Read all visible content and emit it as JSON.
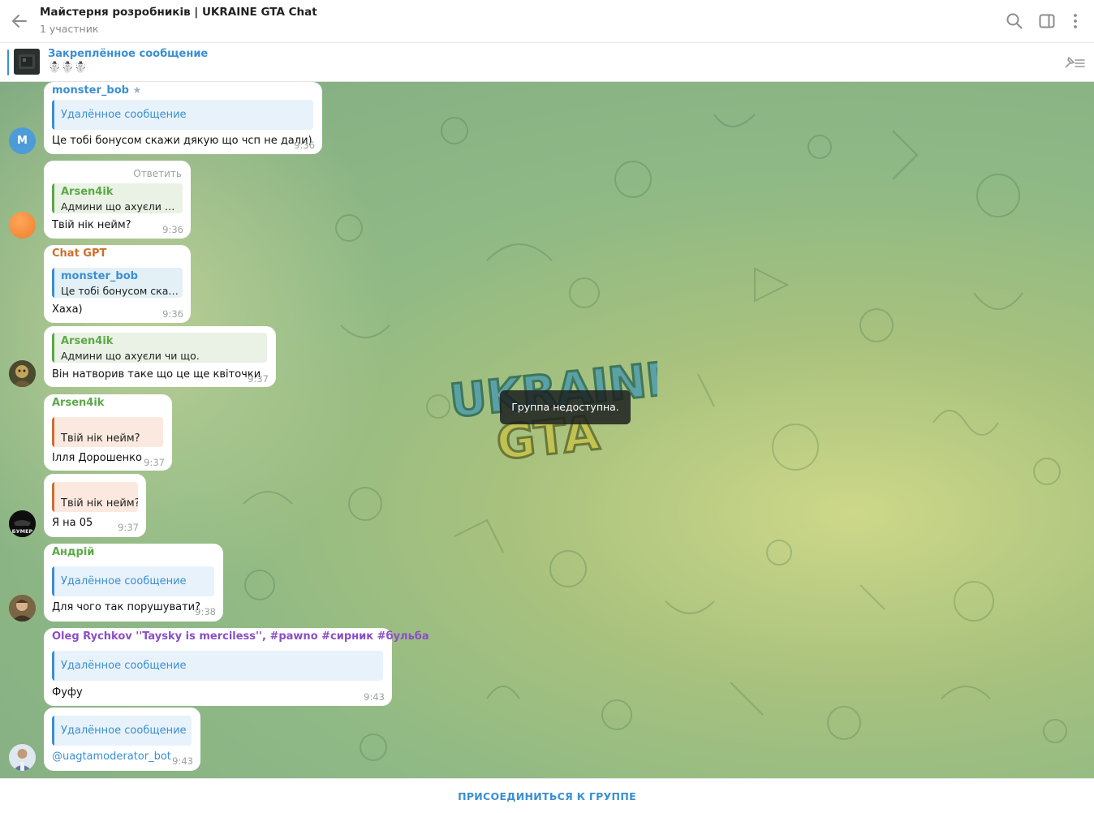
{
  "header": {
    "title": "Майстерня розробників | UKRAINE GTA Chat",
    "subtitle": "1 участник"
  },
  "pinned": {
    "title": "Закреплённое сообщение",
    "text": "☃️☃️☃️"
  },
  "toast": "Группа недоступна.",
  "colors": {
    "accent": "#3a8fd3",
    "monster_bob": "#3a8fd3",
    "arsen4ik": "#5ba946",
    "chat_gpt": "#cc6f2e",
    "andriy": "#5ba946",
    "oleg": "#8a4fc6"
  },
  "messages": [
    {
      "sender": "monster_bob",
      "reply": "Удалённое сообщение",
      "text": "Це тобі бонусом скажи дякую що чсп не дали)",
      "time": "9:36"
    },
    {
      "reply_label": "Ответить",
      "reply_name": "Arsen4ik",
      "reply_text": "Админи що ахуєли чи що.",
      "text": "Твій нік нейм?",
      "time": "9:36"
    },
    {
      "sender": "Chat GPT",
      "reply_name": "monster_bob",
      "reply_text": "Це тобі бонусом скажи дякую що чсп не дали)",
      "text": "Хаха)",
      "time": "9:36"
    },
    {
      "reply_name": "Arsen4ik",
      "reply_text": "Админи що ахуєли чи що.",
      "text": "Він натворив таке що це ще квіточки",
      "time": "9:37"
    },
    {
      "sender": "Arsen4ik",
      "reply_text": "Твій нік нейм?",
      "text": "Ілля Дорошенко",
      "time": "9:37"
    },
    {
      "reply_text": "Твій нік нейм?",
      "text": "Я на 05",
      "time": "9:37"
    },
    {
      "sender": "Андрій",
      "reply": "Удалённое сообщение",
      "text": "Для чого так порушувати?",
      "time": "9:38"
    },
    {
      "sender": "Oleg Rychkov ''Taysky is merciless'', #pawno #сирник #бульба",
      "reply": "Удалённое сообщение",
      "text": "Фуфу",
      "time": "9:43"
    },
    {
      "reply": "Удалённое сообщение",
      "text": "@uagtamoderator_bot",
      "time": "9:43"
    }
  ],
  "avatars": {
    "monster_bob_initial": "M",
    "bumer_label": "БУМЕР"
  },
  "bottom": {
    "join_label": "ПРИСОЕДИНИТЬСЯ К ГРУППЕ"
  }
}
